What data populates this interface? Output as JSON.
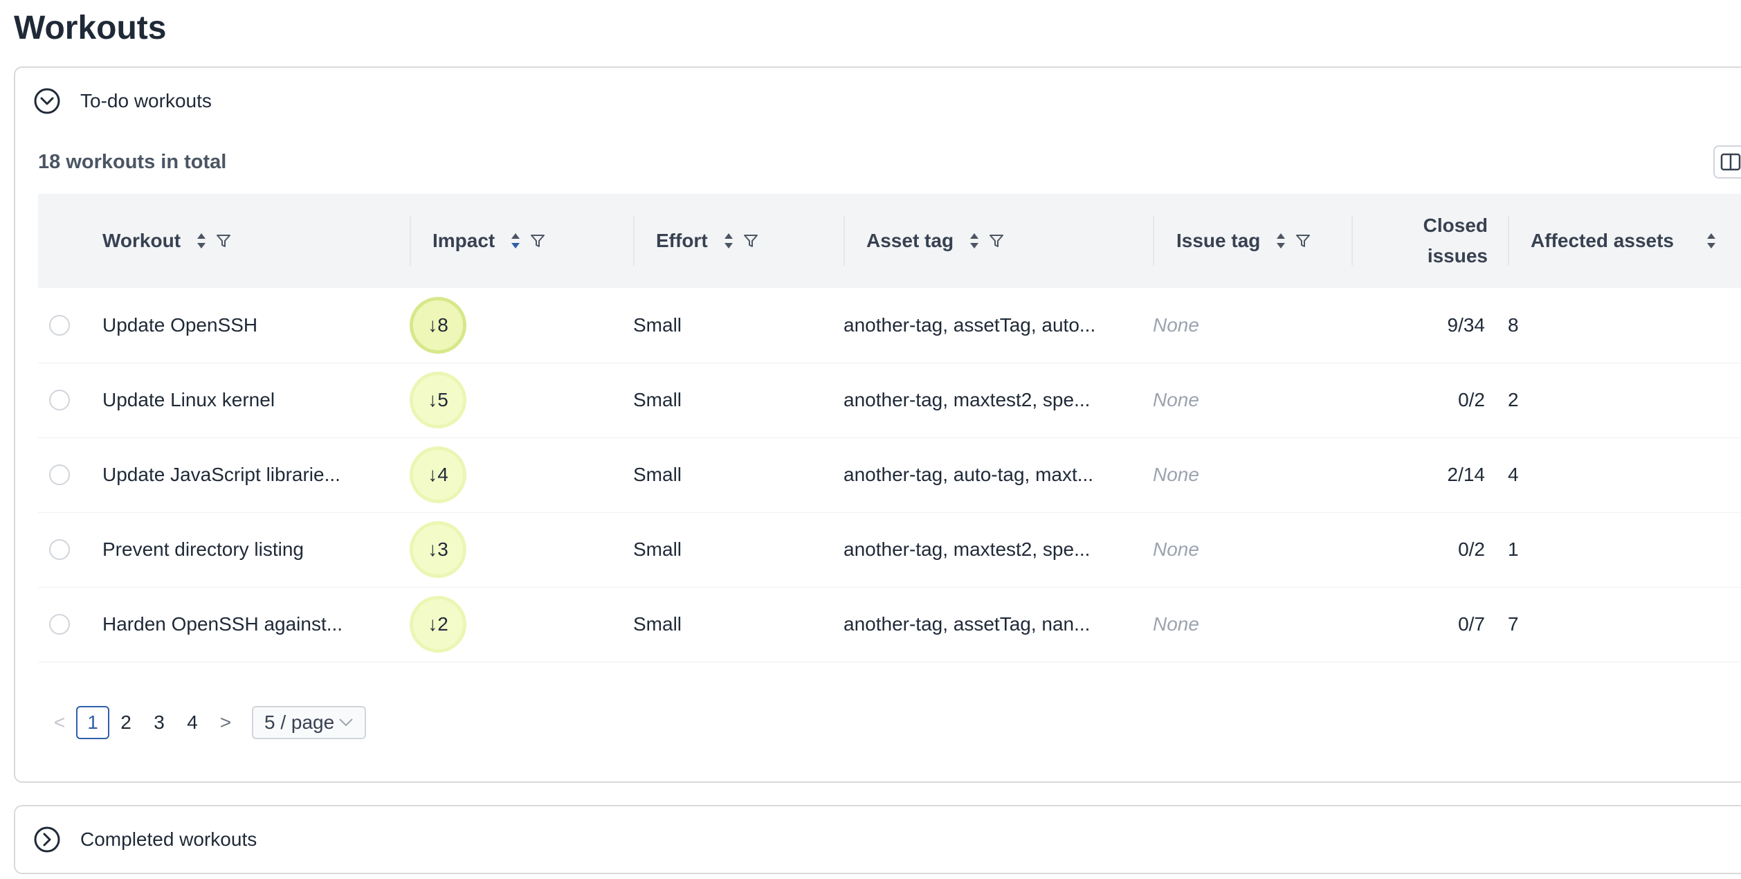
{
  "page": {
    "title": "Workouts"
  },
  "todo_panel": {
    "label": "To-do workouts",
    "total_text": "18 workouts in total",
    "columns": {
      "workout": "Workout",
      "impact": "Impact",
      "effort": "Effort",
      "asset_tag": "Asset tag",
      "issue_tag": "Issue tag",
      "closed_issues_line1": "Closed",
      "closed_issues_line2": "issues",
      "affected_assets": "Affected assets"
    },
    "rows": [
      {
        "workout": "Update OpenSSH",
        "impact": "↓8",
        "effort": "Small",
        "asset_tag": "another-tag, assetTag, auto...",
        "issue_tag": "None",
        "closed_issues": "9/34",
        "affected_assets": "8"
      },
      {
        "workout": "Update Linux kernel",
        "impact": "↓5",
        "effort": "Small",
        "asset_tag": "another-tag, maxtest2, spe...",
        "issue_tag": "None",
        "closed_issues": "0/2",
        "affected_assets": "2"
      },
      {
        "workout": "Update JavaScript librarie...",
        "impact": "↓4",
        "effort": "Small",
        "asset_tag": "another-tag, auto-tag, maxt...",
        "issue_tag": "None",
        "closed_issues": "2/14",
        "affected_assets": "4"
      },
      {
        "workout": "Prevent directory listing",
        "impact": "↓3",
        "effort": "Small",
        "asset_tag": "another-tag, maxtest2, spe...",
        "issue_tag": "None",
        "closed_issues": "0/2",
        "affected_assets": "1"
      },
      {
        "workout": "Harden OpenSSH against...",
        "impact": "↓2",
        "effort": "Small",
        "asset_tag": "another-tag, assetTag, nan...",
        "issue_tag": "None",
        "closed_issues": "0/7",
        "affected_assets": "7"
      }
    ],
    "pagination": {
      "prev": "<",
      "pages": [
        "1",
        "2",
        "3",
        "4"
      ],
      "current": "1",
      "next": ">",
      "page_size": "5 / page"
    }
  },
  "done_panel": {
    "label": "Completed workouts"
  },
  "colors": {
    "accent": "#2f5fa8",
    "header_bg": "#f3f4f6",
    "impact_badge": "#eef7b7"
  }
}
